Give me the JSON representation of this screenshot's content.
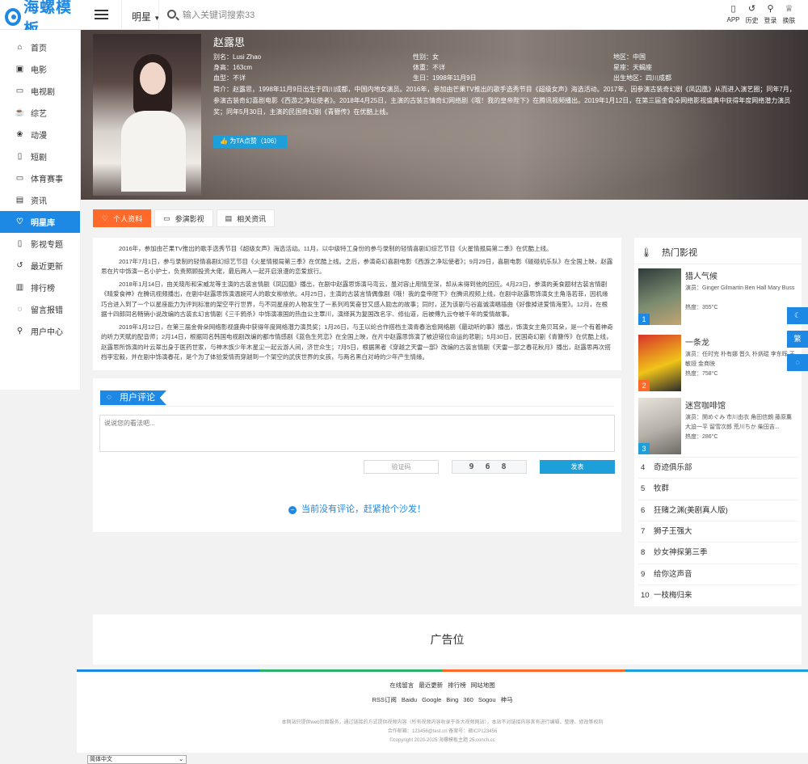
{
  "header": {
    "logo_text": "海螺模板",
    "category": "明星",
    "search_placeholder": "输入关键词搜索33",
    "actions": [
      {
        "label": "APP",
        "icon": "mobile-icon",
        "glyph": "▯"
      },
      {
        "label": "历史",
        "icon": "history-icon",
        "glyph": "↺"
      },
      {
        "label": "登录",
        "icon": "user-icon",
        "glyph": "⚲"
      },
      {
        "label": "换肤",
        "icon": "shirt-icon",
        "glyph": "♕"
      }
    ]
  },
  "sidebar": {
    "items": [
      {
        "label": "首页",
        "icon": "home-icon",
        "glyph": "⌂",
        "active": false
      },
      {
        "label": "电影",
        "icon": "film-icon",
        "glyph": "▣",
        "active": false
      },
      {
        "label": "电视剧",
        "icon": "tv-icon",
        "glyph": "▭",
        "active": false
      },
      {
        "label": "综艺",
        "icon": "coffee-icon",
        "glyph": "☕",
        "active": false
      },
      {
        "label": "动漫",
        "icon": "paw-icon",
        "glyph": "❀",
        "active": false
      },
      {
        "label": "短剧",
        "icon": "mobile-icon",
        "glyph": "▯",
        "active": false
      },
      {
        "label": "体育赛事",
        "icon": "monitor-icon",
        "glyph": "▭",
        "active": false
      },
      {
        "label": "资讯",
        "icon": "document-icon",
        "glyph": "▤",
        "active": false
      },
      {
        "label": "明星库",
        "icon": "heart-icon",
        "glyph": "♡",
        "active": true
      },
      {
        "label": "影视专题",
        "icon": "bookmark-icon",
        "glyph": "▯",
        "active": false
      },
      {
        "label": "最近更新",
        "icon": "history-icon",
        "glyph": "↺",
        "active": false
      },
      {
        "label": "排行榜",
        "icon": "bar-chart-icon",
        "glyph": "▥",
        "active": false
      },
      {
        "label": "留言报错",
        "icon": "comment-icon",
        "glyph": "◌",
        "active": false
      },
      {
        "label": "用户中心",
        "icon": "user-icon",
        "glyph": "⚲",
        "active": false
      }
    ]
  },
  "star": {
    "name": "赵露思",
    "fields": [
      "别名：Lusi Zhao",
      "性别：女",
      "地区：中国",
      "身高：163cm",
      "体重：不详",
      "星座：天蝎座",
      "血型：不详",
      "生日：1998年11月9日",
      "出生地区：四川成都"
    ],
    "intro": "简介：赵露思，1998年11月9日出生于四川成都，中国内地女演员。2016年，参加由芒果TV推出的歌手选秀节目《超级女声》海选活动。2017年，因参演古装奇幻剧《凤囚凰》从而进入演艺圈；同年7月，参演古装奇幻喜剧电影《西游之净坛使者》。2018年4月25日，主演的古装言情奇幻网络剧《哦！我的皇帝陛下》在腾讯视频播出。2019年1月12日，在第三届金骨朵网络影视盛典中获得年度网络潜力演员奖；同年5月30日，主演的民国奇幻剧《青簪传》在优酷上线。",
    "vote_label": "为TA点赞（106）"
  },
  "tabs": [
    {
      "label": "个人资料",
      "icon": "heart-icon",
      "glyph": "♡",
      "active": true
    },
    {
      "label": "参演影视",
      "icon": "monitor-icon",
      "glyph": "▭",
      "active": false
    },
    {
      "label": "相关资讯",
      "icon": "document-icon",
      "glyph": "▤",
      "active": false
    }
  ],
  "bio": [
    "2016年，参加由芒果TV推出的歌手选秀节目《超级女声》海选活动。11月，以中级特工身份的参与录制的轻情喜剧幻综艺节目《火星情报局第二季》在优酷上线。",
    "2017年7月1日，参与录制的轻情喜剧幻综艺节目《火星情报局第三季》在优酷上线。之后，参演奇幻喜剧电影《西游之净坛使者》；9月29日，喜剧电影《碰碰机乐队》在全国上映，赵露思在片中饰演一名小护士，负责照顾投资大佬，最后两人一起开启浪漫的恋爱旅行。",
    "2018年1月14日，由关晓彤和宋威龙等主演的古装言情剧《凤囚凰》播出，在剧中赵露思饰演马弯云，虽对容止用情至深，却从未得到他的回应。4月23日，参演的美食题材古装言情剧《晴爱食神》在腾讯视频播出，在剧中赵露思饰演温婉可人的歌女柳依依。4月25日，主演的古装言情偶像剧《哦！我的皇帝陛下》在腾讯视频上线，在剧中赵露思饰演女主角洛若菲，因机缘巧合进入到了一个以星座能力为评判标准的架空平行世界，与不同星座的人物发生了一系列鸡笑奋甘又感人励志的故事；同时，还为该剧与谷嘉诚演唱插曲《好像掉进爱情海里》。12月，在根据十四郎同名畅销小说改编的古装玄幻言情剧《三千鸦杀》中饰演凛国的热血公主覃川，演绎其为复国改名字、修仙道，后被傅九云夺被千年的爱情故事。",
    "2019年1月12日，在第三届金骨朵网络影视盛典中获得年度网络潜力演员奖；1月26日，与王以纶合作搭档主演青春治愈网络剧《最动听的事》播出，饰演女主角贝耳朵，是一个有着神奇的听力天赋的配音师；2月14日，根据同名韩国电视剧改编的都市情感剧《蓝色生死恋》在全国上映，在片中赵露思饰演了被迫错位命运的悲剧；5月30日，民国奇幻剧《青簪传》在优酷上线，赵露思所饰演的叶云翠出身于医药世家，与神木族少年木星尘一起云游人间，济世众生；7月5日，根据黑者《穿越之天雷一部》改编的古装言情剧《天雷一部之春花秋月》播出，赵露思再次搭档李宏毅，并在剧中饰演春花，是个为了体验爱情而穿越到一个架空的武侠世界的女孩，与两名黑白对峙的少年产生情缘。"
  ],
  "comments": {
    "title": "用户评论",
    "placeholder": "说说您的看法吧...",
    "captcha_placeholder": "验证码",
    "captcha_code": "9 6 8",
    "submit_label": "发表",
    "empty_text": "当前没有评论，赶紧抢个沙发！"
  },
  "hot": {
    "title": "热门影视",
    "top": [
      {
        "rank": "1",
        "name": "猎人气候",
        "actors": "演员：Ginger Gilmartin Ben Hall Mary Buss",
        "heat": "热度：355°C",
        "colors": [
          "#2e3b3a",
          "#7a8b6f",
          "#c2a574"
        ]
      },
      {
        "rank": "2",
        "name": "一条龙",
        "actors": "演员：任时完 朴有娜 晋久 朴炳琨 李东晖 王敏娅 金商映",
        "heat": "热度：758°C",
        "colors": [
          "#d8332b",
          "#f0c419",
          "#2b2b2b"
        ]
      },
      {
        "rank": "3",
        "name": "迷宫咖啡馆",
        "actors": "演员：関めぐみ 市川由衣 角田信朗 藤原薫 大迫一平 留雪次郎 荒川ちか 柴田吉...",
        "heat": "热度：286°C",
        "colors": [
          "#e8e4dc",
          "#b5b0a8",
          "#6d6a65"
        ]
      }
    ],
    "rest": [
      {
        "rank": "4",
        "name": "奇迹俱乐部"
      },
      {
        "rank": "5",
        "name": "牧群"
      },
      {
        "rank": "6",
        "name": "狂赌之渊(美剧真人版)"
      },
      {
        "rank": "7",
        "name": "狮子王强大"
      },
      {
        "rank": "8",
        "name": "妙女神探第三季"
      },
      {
        "rank": "9",
        "name": "给你这声音"
      },
      {
        "rank": "10",
        "name": "一枝梅归来"
      }
    ]
  },
  "float_tools": [
    {
      "icon": "moon-icon",
      "glyph": "☾"
    },
    {
      "icon": "translate-icon",
      "glyph": "繁"
    },
    {
      "icon": "comment-icon",
      "glyph": "◌"
    }
  ],
  "ad_label": "广告位",
  "footer": {
    "links": [
      "在线留言",
      "最近更新",
      "排行榜",
      "网站地图"
    ],
    "engines": [
      "RSS订阅",
      "Baidu",
      "Google",
      "Bing",
      "360",
      "Sogou",
      "神马"
    ],
    "notes": [
      "本网站只提供web页面服务，通过链接的方式提供视频内容（所有视频内容收录于各大视频网站），本站不对链接内容其有进行编辑、整理、修改等权利",
      "合作邮箱：123456@test.cn 备案号：赣ICP123456",
      "©copyright 2020-2025 海螺模板主题 25.conch.cc"
    ],
    "language": "简体中文"
  }
}
